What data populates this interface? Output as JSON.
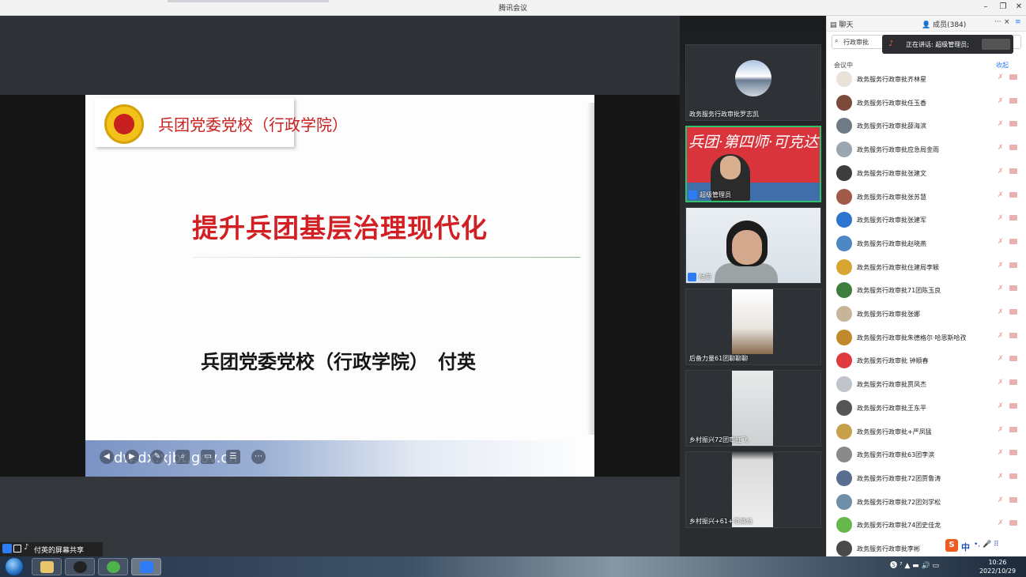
{
  "window": {
    "title": "腾讯会议",
    "minimize": "–",
    "restore": "❐",
    "close": "✕"
  },
  "slide": {
    "logo_text": "兵团党委党校（行政学院）",
    "title": "提升兵团基层治理现代化",
    "author": "兵团党委党校（行政学院）　付英",
    "footer_url": "dw.dx.xjbt.gov.cn"
  },
  "screen_share": {
    "label": "付英的屏幕共享"
  },
  "video_tiles": [
    {
      "name": "政务服务行政审批罗志凯"
    },
    {
      "name": "超级管理员",
      "banner": "兵团·第四师·可克达"
    },
    {
      "name": "付英"
    },
    {
      "name": "后备力量61团聊聊聊"
    },
    {
      "name": "乡村振兴72团审征飞"
    },
    {
      "name": "乡村振兴+61+范高焰"
    }
  ],
  "panel": {
    "tab_chat": "聊天",
    "tab_members": "成员(384)",
    "more": "···",
    "close": "×",
    "menu": "≡",
    "search_value": "行政审批",
    "speaking": "正在讲话: 超级管理员;",
    "section": "会议中",
    "collapse": "收起",
    "members": [
      {
        "name": "政务服务行政审批齐林星",
        "color": "#e8e2d9"
      },
      {
        "name": "政务服务行政审批任玉香",
        "color": "#7c4a3a"
      },
      {
        "name": "政务服务行政审批薛海滨",
        "color": "#6e7b87"
      },
      {
        "name": "政务服务行政审批应急局金雨",
        "color": "#9aa7b3"
      },
      {
        "name": "政务服务行政审批张建文",
        "color": "#3d3d3d"
      },
      {
        "name": "政务服务行政审批张苏慧",
        "color": "#a25a48"
      },
      {
        "name": "政务服务行政审批张建军",
        "color": "#2f74d0"
      },
      {
        "name": "政务服务行政审批赵晓燕",
        "color": "#4d88c4"
      },
      {
        "name": "政务服务行政审批住建局李颖",
        "color": "#d9a531"
      },
      {
        "name": "政务服务行政审批71团陈玉良",
        "color": "#3e7d3b"
      },
      {
        "name": "政务服务行政审批张娜",
        "color": "#c7b59a"
      },
      {
        "name": "政务服务行政审批朱德格尔·哈恩斯哈孜",
        "color": "#c08a2a"
      },
      {
        "name": "政务服务行政审批 钟顺春",
        "color": "#e0393e"
      },
      {
        "name": "政务服务行政审批贾凤杰",
        "color": "#bfc5cb"
      },
      {
        "name": "政务服务行政审批王东平",
        "color": "#555555"
      },
      {
        "name": "政务服务行政审批+严凤猛",
        "color": "#c6a14a"
      },
      {
        "name": "政务服务行政审批63团李滨",
        "color": "#8a8a8a"
      },
      {
        "name": "政务服务行政审批72团贾鲁涛",
        "color": "#5a6f8f"
      },
      {
        "name": "政务服务行政审批72团刘学松",
        "color": "#6f8fa8"
      },
      {
        "name": "政务服务行政审批74团史佳龙",
        "color": "#67b84a"
      },
      {
        "name": "政务服务行政审批李彬",
        "color": "#4a4a4a"
      }
    ]
  },
  "ime": {
    "logo": "S",
    "mode": "中",
    "rest": "•, 🎤 ⠿"
  },
  "taskbar": {
    "time": "10:26",
    "date": "2022/10/29",
    "tray_icons": "🅢 ⁷ ▲ ▬ 🔊 ▭"
  }
}
